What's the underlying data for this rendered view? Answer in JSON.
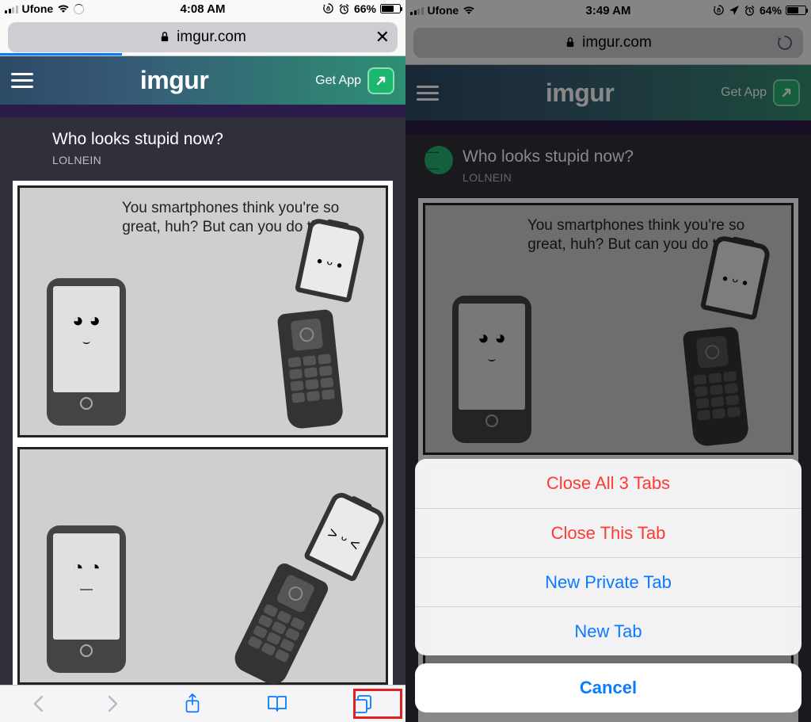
{
  "left": {
    "status": {
      "carrier": "Ufone",
      "time": "4:08 AM",
      "battery_pct": "66%",
      "battery_fill": 66
    },
    "url": {
      "domain": "imgur.com",
      "progress_pct": 30
    },
    "imgur": {
      "logo": "imgur",
      "get_app": "Get App"
    },
    "post": {
      "title": "Who looks stupid now?",
      "author": "LOLNEIN",
      "speech": "You smartphones think you're so great, huh? But can you do this?"
    }
  },
  "right": {
    "status": {
      "carrier": "Ufone",
      "time": "3:49 AM",
      "battery_pct": "64%",
      "battery_fill": 64
    },
    "url": {
      "domain": "imgur.com"
    },
    "imgur": {
      "logo": "imgur",
      "get_app": "Get App"
    },
    "post": {
      "title": "Who looks stupid now?",
      "author": "LOLNEIN",
      "speech": "You smartphones think you're so great, huh? But can you do this?"
    },
    "sheet": {
      "close_all": "Close All 3 Tabs",
      "close_this": "Close This Tab",
      "new_private": "New Private Tab",
      "new_tab": "New Tab",
      "cancel": "Cancel"
    }
  }
}
